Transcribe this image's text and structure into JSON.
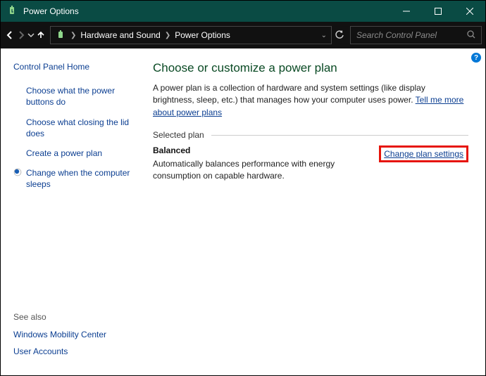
{
  "window": {
    "title": "Power Options"
  },
  "breadcrumb": {
    "items": [
      "Hardware and Sound",
      "Power Options"
    ]
  },
  "search": {
    "placeholder": "Search Control Panel"
  },
  "help_badge": "?",
  "sidebar": {
    "home": "Control Panel Home",
    "links": [
      {
        "label": "Choose what the power buttons do",
        "active": false
      },
      {
        "label": "Choose what closing the lid does",
        "active": false
      },
      {
        "label": "Create a power plan",
        "active": false
      },
      {
        "label": "Change when the computer sleeps",
        "active": true
      }
    ],
    "seealso_title": "See also",
    "seealso": [
      "Windows Mobility Center",
      "User Accounts"
    ]
  },
  "main": {
    "heading": "Choose or customize a power plan",
    "description": "A power plan is a collection of hardware and system settings (like display brightness, sleep, etc.) that manages how your computer uses power. ",
    "description_link": "Tell me more about power plans",
    "section_label": "Selected plan",
    "plan": {
      "name": "Balanced",
      "desc": "Automatically balances performance with energy consumption on capable hardware.",
      "change_link": "Change plan settings"
    }
  }
}
